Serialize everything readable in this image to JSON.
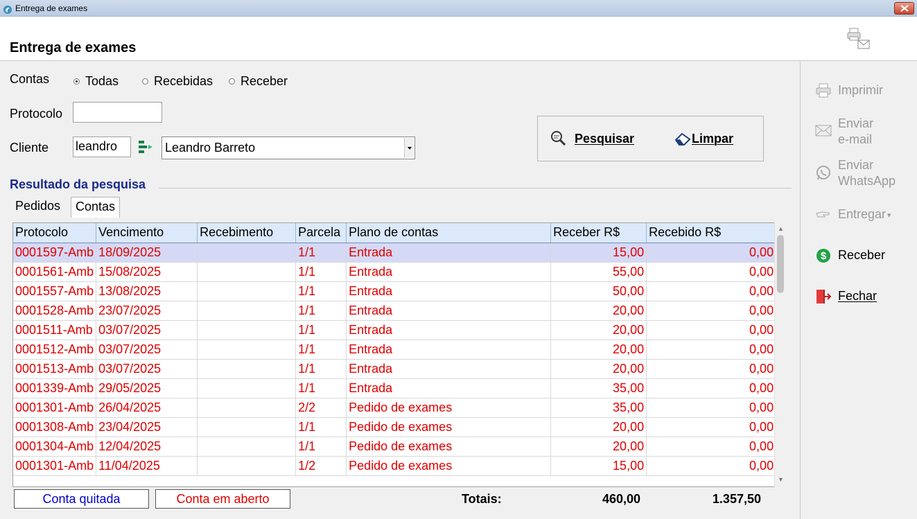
{
  "window": {
    "title": "Entrega de exames"
  },
  "header": {
    "title": "Entrega de exames"
  },
  "form": {
    "contas_label": "Contas",
    "radios": [
      {
        "label": "Todas",
        "checked": true
      },
      {
        "label": "Recebidas",
        "checked": false
      },
      {
        "label": "Receber",
        "checked": false
      }
    ],
    "protocolo_label": "Protocolo",
    "protocolo_value": "",
    "cliente_label": "Cliente",
    "cliente_code": "leandro",
    "cliente_name": "Leandro Barreto"
  },
  "search": {
    "pesquisar": "Pesquisar",
    "limpar": "Limpar"
  },
  "results": {
    "title": "Resultado da pesquisa",
    "tabs": [
      {
        "label": "Pedidos",
        "active": false
      },
      {
        "label": "Contas",
        "active": true
      }
    ],
    "columns": [
      "Protocolo",
      "Vencimento",
      "Recebimento",
      "Parcela",
      "Plano de contas",
      "Receber R$",
      "Recebido R$"
    ],
    "rows": [
      [
        "0001597-Amb",
        "18/09/2025",
        "",
        "1/1",
        "Entrada",
        "15,00",
        "0,00"
      ],
      [
        "0001561-Amb",
        "15/08/2025",
        "",
        "1/1",
        "Entrada",
        "55,00",
        "0,00"
      ],
      [
        "0001557-Amb",
        "13/08/2025",
        "",
        "1/1",
        "Entrada",
        "50,00",
        "0,00"
      ],
      [
        "0001528-Amb",
        "23/07/2025",
        "",
        "1/1",
        "Entrada",
        "20,00",
        "0,00"
      ],
      [
        "0001511-Amb",
        "03/07/2025",
        "",
        "1/1",
        "Entrada",
        "20,00",
        "0,00"
      ],
      [
        "0001512-Amb",
        "03/07/2025",
        "",
        "1/1",
        "Entrada",
        "20,00",
        "0,00"
      ],
      [
        "0001513-Amb",
        "03/07/2025",
        "",
        "1/1",
        "Entrada",
        "20,00",
        "0,00"
      ],
      [
        "0001339-Amb",
        "29/05/2025",
        "",
        "1/1",
        "Entrada",
        "35,00",
        "0,00"
      ],
      [
        "0001301-Amb",
        "26/04/2025",
        "",
        "2/2",
        "Pedido de exames",
        "35,00",
        "0,00"
      ],
      [
        "0001308-Amb",
        "23/04/2025",
        "",
        "1/1",
        "Pedido de exames",
        "20,00",
        "0,00"
      ],
      [
        "0001304-Amb",
        "12/04/2025",
        "",
        "1/1",
        "Pedido de exames",
        "20,00",
        "0,00"
      ],
      [
        "0001301-Amb",
        "11/04/2025",
        "",
        "1/2",
        "Pedido de exames",
        "15,00",
        "0,00"
      ]
    ]
  },
  "legend": {
    "quitada": "Conta quitada",
    "aberto": "Conta em aberto"
  },
  "totals": {
    "label": "Totais:",
    "receber": "460,00",
    "recebido": "1.357,50"
  },
  "sidebar": {
    "imprimir": "Imprimir",
    "email_1": "Enviar",
    "email_2": "e-mail",
    "whatsapp_1": "Enviar",
    "whatsapp_2": "WhatsApp",
    "entregar": "Entregar",
    "receber": "Receber",
    "fechar": "Fechar"
  },
  "colors": {
    "accent_title": "#1c2a8c",
    "open_account": "#e00000",
    "paid_account": "#0000cc",
    "selected_row": "#d5d9f5"
  }
}
